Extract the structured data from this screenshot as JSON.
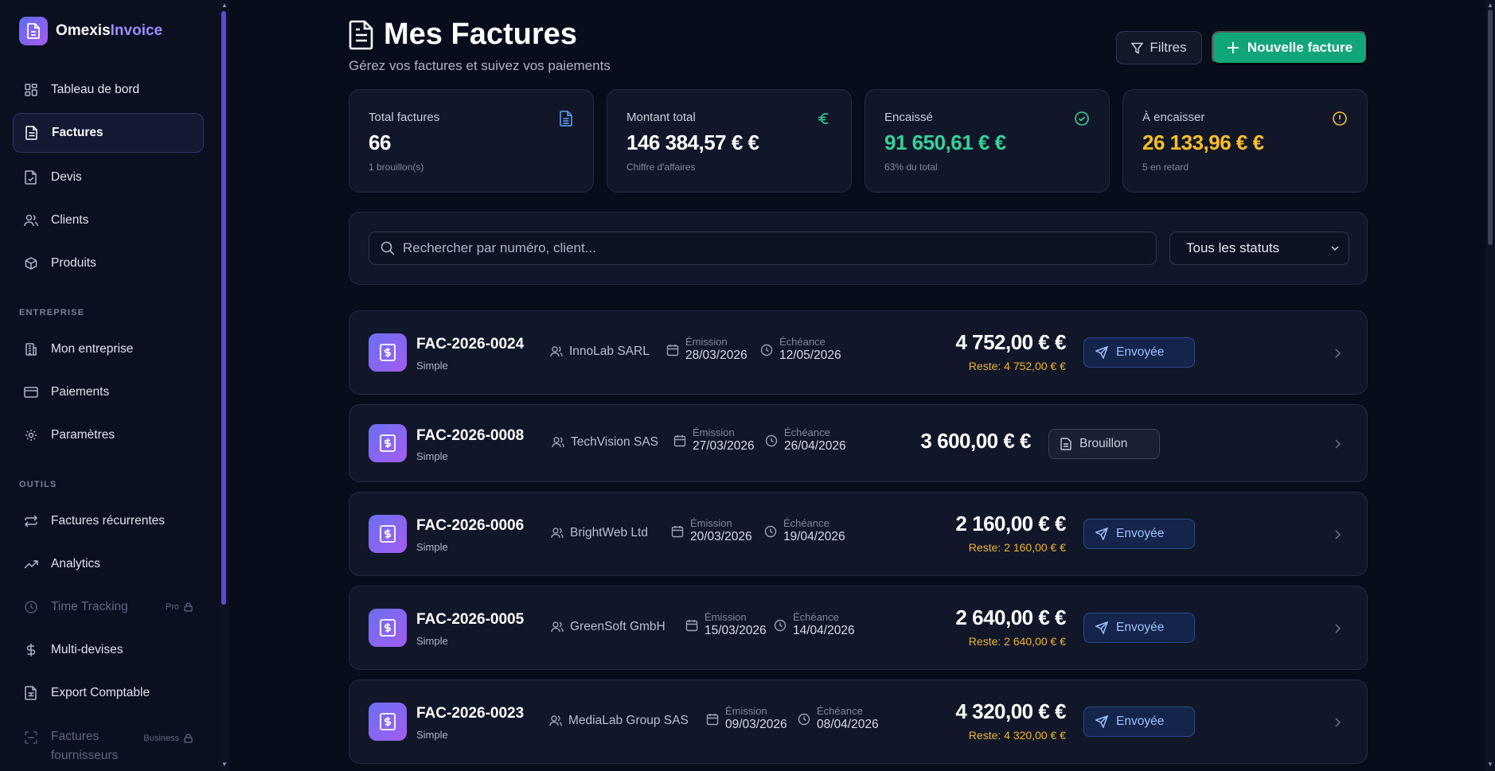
{
  "app": {
    "name_main": "Omexis",
    "name_accent": "Invoice"
  },
  "sidebar": {
    "items": [
      {
        "label": "Tableau de bord"
      },
      {
        "label": "Factures"
      },
      {
        "label": "Devis"
      },
      {
        "label": "Clients"
      },
      {
        "label": "Produits"
      }
    ],
    "section_entreprise": "ENTREPRISE",
    "entreprise_items": [
      {
        "label": "Mon entreprise"
      },
      {
        "label": "Paiements"
      },
      {
        "label": "Paramètres"
      }
    ],
    "section_outils": "OUTILS",
    "outils_items": [
      {
        "label": "Factures récurrentes"
      },
      {
        "label": "Analytics"
      },
      {
        "label": "Time Tracking",
        "badge": "Pro"
      },
      {
        "label": "Multi-devises"
      },
      {
        "label": "Export Comptable"
      },
      {
        "label_line1": "Factures",
        "label_line2": "fournisseurs",
        "badge": "Business"
      }
    ]
  },
  "header": {
    "title": "Mes Factures",
    "subtitle": "Gérez vos factures et suivez vos paiements",
    "filter_label": "Filtres",
    "new_label": "Nouvelle facture"
  },
  "stats": [
    {
      "label": "Total factures",
      "value": "66",
      "sub": "1 brouillon(s)",
      "color": "#ffffff"
    },
    {
      "label": "Montant total",
      "value": "146 384,57 € €",
      "sub": "Chiffre d'affaires",
      "color": "#ffffff"
    },
    {
      "label": "Encaissé",
      "value": "91 650,61 € €",
      "sub": "63% du total",
      "color": "#34d399"
    },
    {
      "label": "À encaisser",
      "value": "26 133,96 € €",
      "sub": "5 en retard",
      "color": "#fbbf24"
    }
  ],
  "search": {
    "placeholder": "Rechercher par numéro, client...",
    "status_selected": "Tous les statuts"
  },
  "invoices": [
    {
      "number": "FAC-2026-0024",
      "type": "Simple",
      "client": "InnoLab SARL",
      "emission_label": "Émission",
      "emission": "28/03/2026",
      "due_label": "Échéance",
      "due": "12/05/2026",
      "amount": "4 752,00 € €",
      "reste": "Reste: 4 752,00 € €",
      "status": "Envoyée"
    },
    {
      "number": "FAC-2026-0008",
      "type": "Simple",
      "client": "TechVision SAS",
      "emission_label": "Émission",
      "emission": "27/03/2026",
      "due_label": "Échéance",
      "due": "26/04/2026",
      "amount": "3 600,00 € €",
      "reste": "",
      "status": "Brouillon"
    },
    {
      "number": "FAC-2026-0006",
      "type": "Simple",
      "client": "BrightWeb Ltd",
      "emission_label": "Émission",
      "emission": "20/03/2026",
      "due_label": "Échéance",
      "due": "19/04/2026",
      "amount": "2 160,00 € €",
      "reste": "Reste: 2 160,00 € €",
      "status": "Envoyée"
    },
    {
      "number": "FAC-2026-0005",
      "type": "Simple",
      "client": "GreenSoft GmbH",
      "emission_label": "Émission",
      "emission": "15/03/2026",
      "due_label": "Échéance",
      "due": "14/04/2026",
      "amount": "2 640,00 € €",
      "reste": "Reste: 2 640,00 € €",
      "status": "Envoyée"
    },
    {
      "number": "FAC-2026-0023",
      "type": "Simple",
      "client": "MediaLab Group SAS",
      "emission_label": "Émission",
      "emission": "09/03/2026",
      "due_label": "Échéance",
      "due": "08/04/2026",
      "amount": "4 320,00 € €",
      "reste": "Reste: 4 320,00 € €",
      "status": "Envoyée"
    }
  ],
  "colors": {
    "accent": "#11a57a",
    "brand": "#6a70f4",
    "warning": "#f0b429",
    "success": "#34d399"
  }
}
